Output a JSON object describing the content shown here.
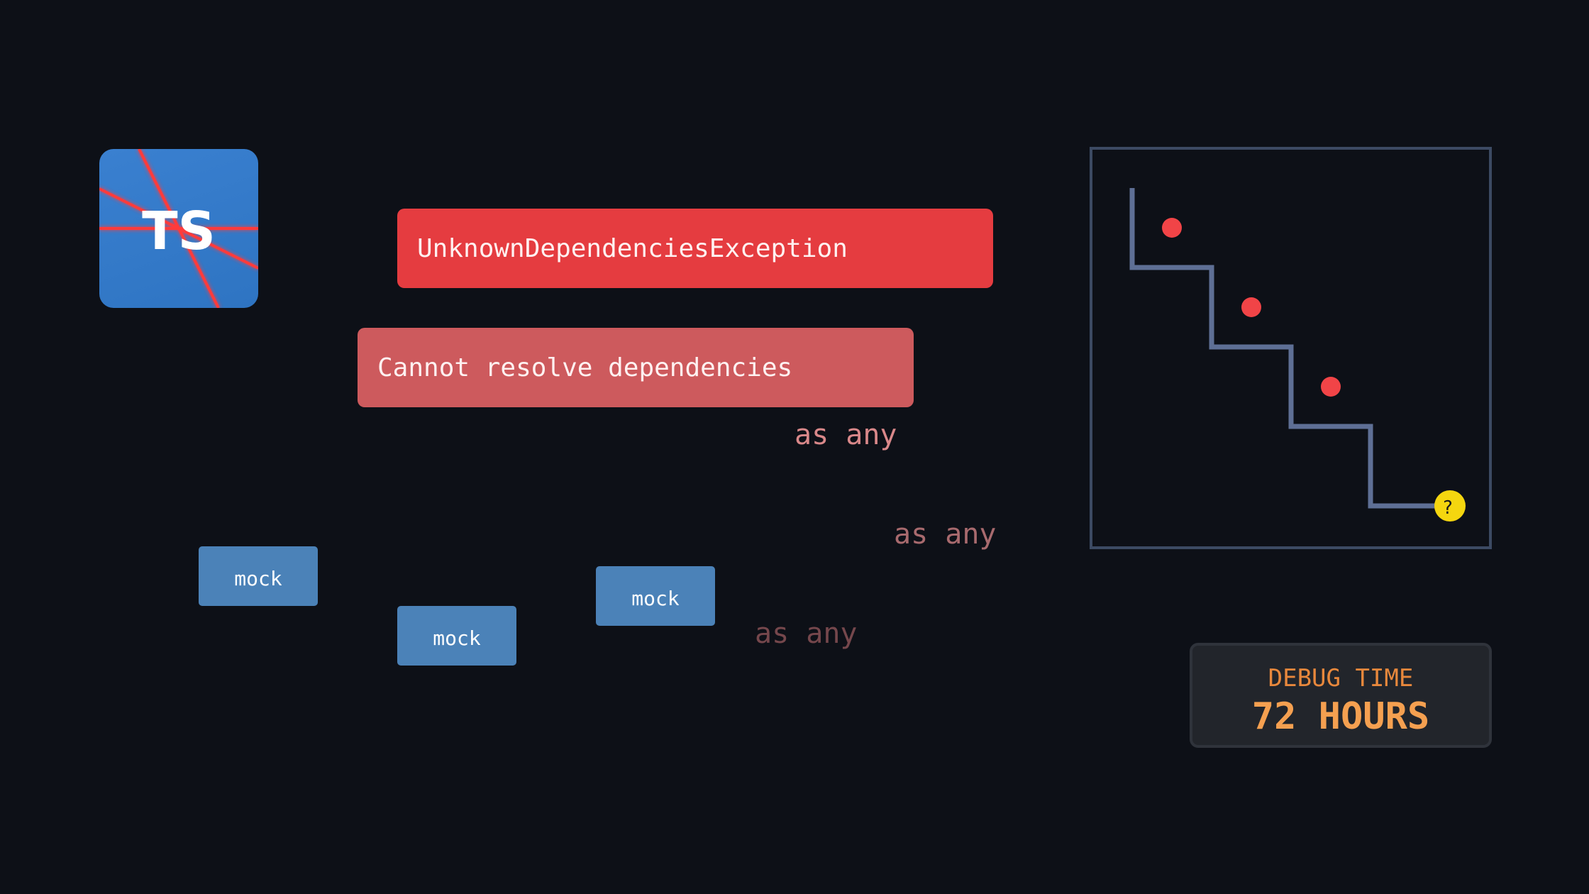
{
  "logo": {
    "text": "TS"
  },
  "errors": {
    "primary": "UnknownDependenciesException",
    "secondary": "Cannot resolve dependencies"
  },
  "casts": [
    "as any",
    "as any",
    "as any"
  ],
  "mocks": [
    "mock",
    "mock",
    "mock"
  ],
  "maze": {
    "end_marker": "?"
  },
  "debug": {
    "label": "DEBUG TIME",
    "value": "72 HOURS"
  },
  "colors": {
    "background": "#0d1017",
    "error_primary": "#e53c40",
    "error_secondary": "#cd5a5d",
    "mock": "#4b82b8",
    "ts_blue": "#3178c6",
    "maze_line": "#5e6f95",
    "maze_dot": "#f14447",
    "maze_goal": "#f5d60f",
    "debug_text": "#f5a050"
  }
}
